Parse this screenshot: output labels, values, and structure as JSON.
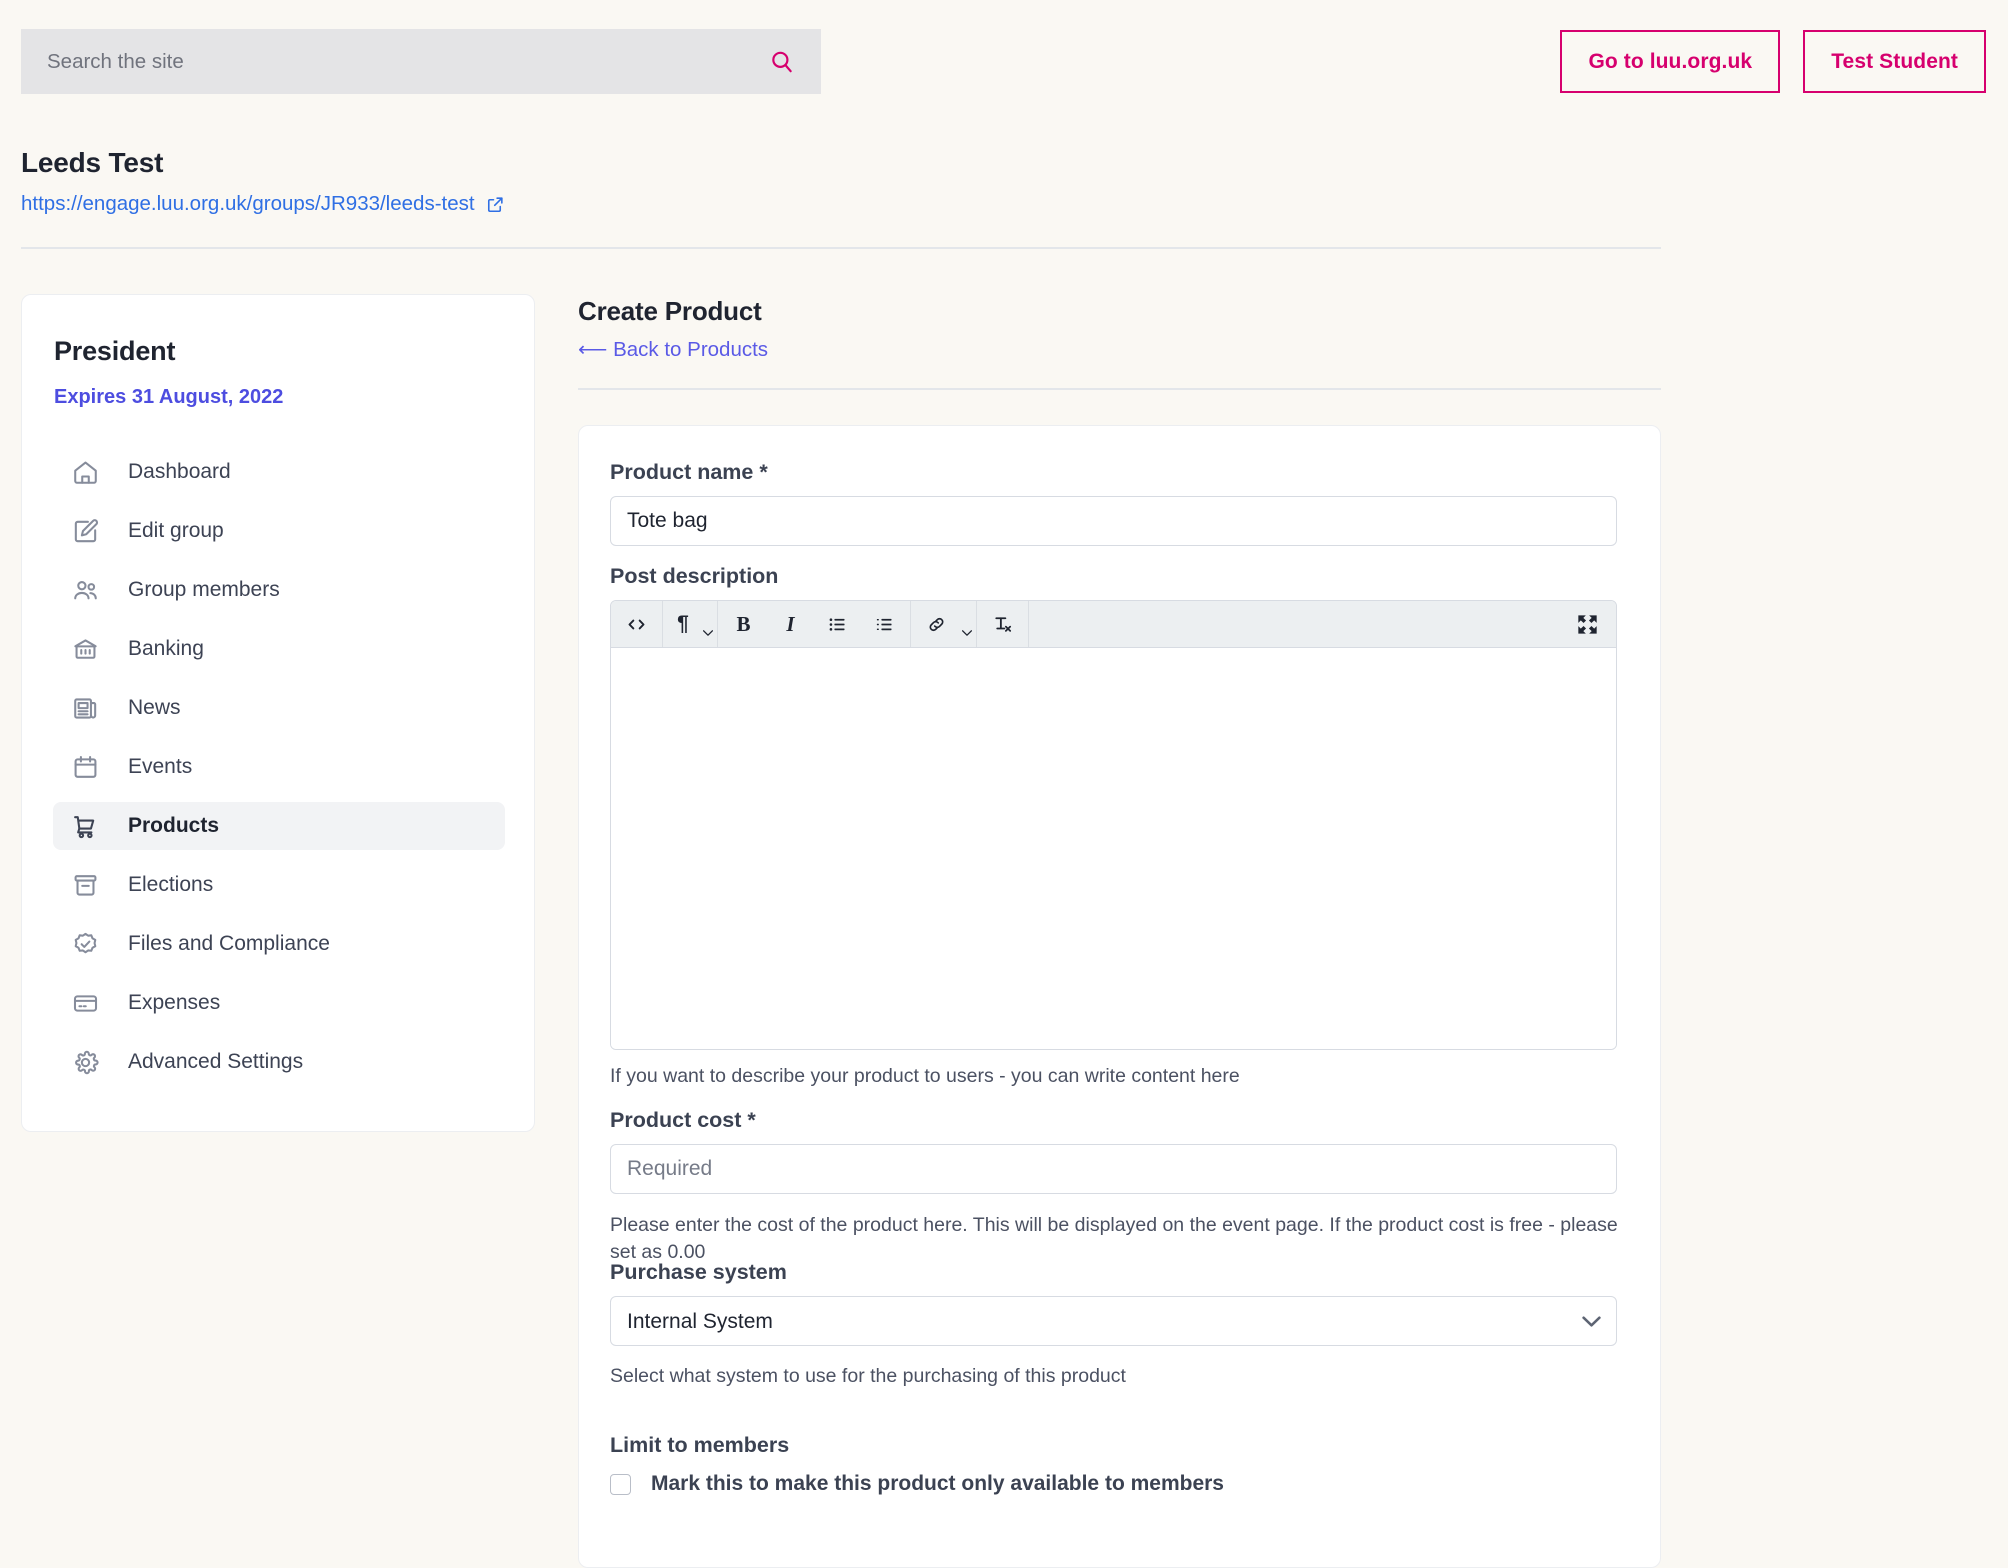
{
  "topbar": {
    "search": {
      "placeholder": "Search the site",
      "value": "",
      "icon": "search-icon"
    },
    "buttons": [
      {
        "label": "Go to luu.org.uk",
        "name": "go-to-luu-button"
      },
      {
        "label": "Test Student",
        "name": "test-student-button"
      }
    ],
    "accent_pink": "#d6006e"
  },
  "group": {
    "title": "Leeds Test",
    "url": "https://engage.luu.org.uk/groups/JR933/leeds-test",
    "url_color": "#2f6fe4",
    "external_icon": "external-link-icon"
  },
  "sidebar": {
    "role": "President",
    "expires": "Expires 31 August, 2022",
    "expires_color": "#4d4de0",
    "items": [
      {
        "label": "Dashboard",
        "icon": "home-icon",
        "active": false
      },
      {
        "label": "Edit group",
        "icon": "pencil-square-icon",
        "active": false
      },
      {
        "label": "Group members",
        "icon": "users-icon",
        "active": false
      },
      {
        "label": "Banking",
        "icon": "bank-icon",
        "active": false
      },
      {
        "label": "News",
        "icon": "newspaper-icon",
        "active": false
      },
      {
        "label": "Events",
        "icon": "calendar-icon",
        "active": false
      },
      {
        "label": "Products",
        "icon": "shopping-cart-icon",
        "active": true
      },
      {
        "label": "Elections",
        "icon": "ballot-box-icon",
        "active": false
      },
      {
        "label": "Files and Compliance",
        "icon": "badge-check-icon",
        "active": false
      },
      {
        "label": "Expenses",
        "icon": "credit-card-icon",
        "active": false
      },
      {
        "label": "Advanced Settings",
        "icon": "gear-icon",
        "active": false
      }
    ]
  },
  "main": {
    "title": "Create Product",
    "back_link": "⟵ Back to Products",
    "form": {
      "product_name": {
        "label": "Product name *",
        "value": "Tote bag",
        "placeholder": ""
      },
      "post_description": {
        "label": "Post description",
        "value": "",
        "help": "If you want to describe your product to users - you can write content here",
        "toolbar": [
          {
            "name": "source-code-icon",
            "glyph": "<>"
          },
          {
            "name": "paragraph-format-icon",
            "glyph": "¶",
            "has_caret": true
          },
          {
            "name": "bold-icon",
            "glyph": "B"
          },
          {
            "name": "italic-icon",
            "glyph": "I"
          },
          {
            "name": "unordered-list-icon",
            "glyph": "☰"
          },
          {
            "name": "ordered-list-icon",
            "glyph": "☰"
          },
          {
            "name": "insert-link-icon",
            "glyph": "🔗",
            "has_caret": true
          },
          {
            "name": "clear-formatting-icon",
            "glyph": "Tx"
          },
          {
            "name": "fullscreen-icon",
            "glyph": "⤡"
          }
        ]
      },
      "product_cost": {
        "label": "Product cost *",
        "value": "",
        "placeholder": "Required",
        "help": "Please enter the cost of the product here. This will be displayed on the event page. If the product cost is free - please set as 0.00"
      },
      "purchase_system": {
        "label": "Purchase system",
        "selected": "Internal System",
        "options": [
          "Internal System"
        ],
        "help": "Select what system to use for the purchasing of this product"
      },
      "limit_to_members": {
        "label": "Limit to members",
        "checkbox_label": "Mark this to make this product only available to members",
        "checked": false
      }
    }
  }
}
